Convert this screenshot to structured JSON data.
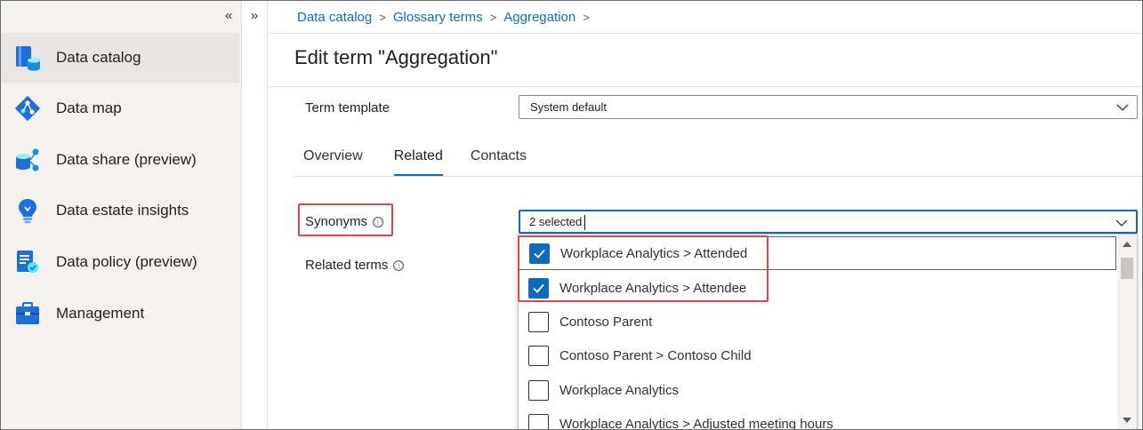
{
  "nav": {
    "collapse_icon": "«",
    "expand_icon": "»",
    "items": [
      {
        "label": "Data catalog",
        "icon": "data-catalog-icon",
        "active": true
      },
      {
        "label": "Data map",
        "icon": "data-map-icon"
      },
      {
        "label": "Data share (preview)",
        "icon": "data-share-icon"
      },
      {
        "label": "Data estate insights",
        "icon": "insights-icon"
      },
      {
        "label": "Data policy (preview)",
        "icon": "data-policy-icon"
      },
      {
        "label": "Management",
        "icon": "management-icon"
      }
    ]
  },
  "breadcrumb": {
    "items": [
      "Data catalog",
      "Glossary terms",
      "Aggregation"
    ],
    "separator": ">"
  },
  "page": {
    "title": "Edit term \"Aggregation\""
  },
  "form": {
    "term_template": {
      "label": "Term template",
      "value": "System default"
    },
    "tabs": [
      {
        "label": "Overview"
      },
      {
        "label": "Related",
        "active": true
      },
      {
        "label": "Contacts"
      }
    ],
    "synonyms": {
      "label": "Synonyms",
      "value": "2 selected",
      "info_icon": "ⓘ"
    },
    "related_terms": {
      "label": "Related terms",
      "info_icon": "ⓘ"
    }
  },
  "dropdown": {
    "options": [
      {
        "label": "Workplace Analytics > Attended",
        "checked": true
      },
      {
        "label": "Workplace Analytics > Attendee",
        "checked": true
      },
      {
        "label": "Contoso Parent",
        "checked": false
      },
      {
        "label": "Contoso Parent > Contoso Child",
        "checked": false
      },
      {
        "label": "Workplace Analytics",
        "checked": false
      },
      {
        "label": "Workplace Analytics > Adjusted meeting hours",
        "checked": false
      }
    ]
  },
  "colors": {
    "accent": "#0f6cbd",
    "highlight": "#e0454b",
    "nav_bg": "#f3f2f1"
  }
}
